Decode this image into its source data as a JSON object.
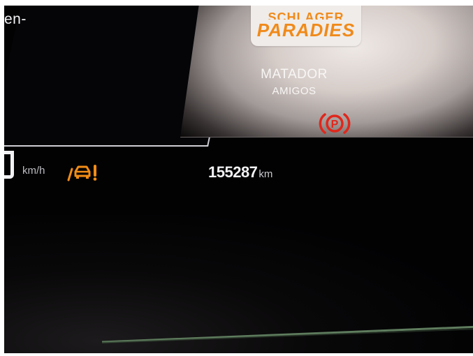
{
  "navigation": {
    "instruction_fragment": "en-"
  },
  "media": {
    "album_top_text": "SCHLAGER",
    "album_main_text": "PARADIES",
    "track_title": "MATADOR",
    "track_artist": "AMIGOS"
  },
  "indicators": {
    "parking_brake_symbol": "P",
    "parking_brake_color": "#e0271c",
    "adas_warning_color": "#f28c16"
  },
  "speed": {
    "unit": "km/h"
  },
  "odometer": {
    "value": "155287",
    "unit": "km"
  },
  "colors": {
    "accent_orange": "#f08a1a",
    "arc_green": "#5f7d5e"
  }
}
